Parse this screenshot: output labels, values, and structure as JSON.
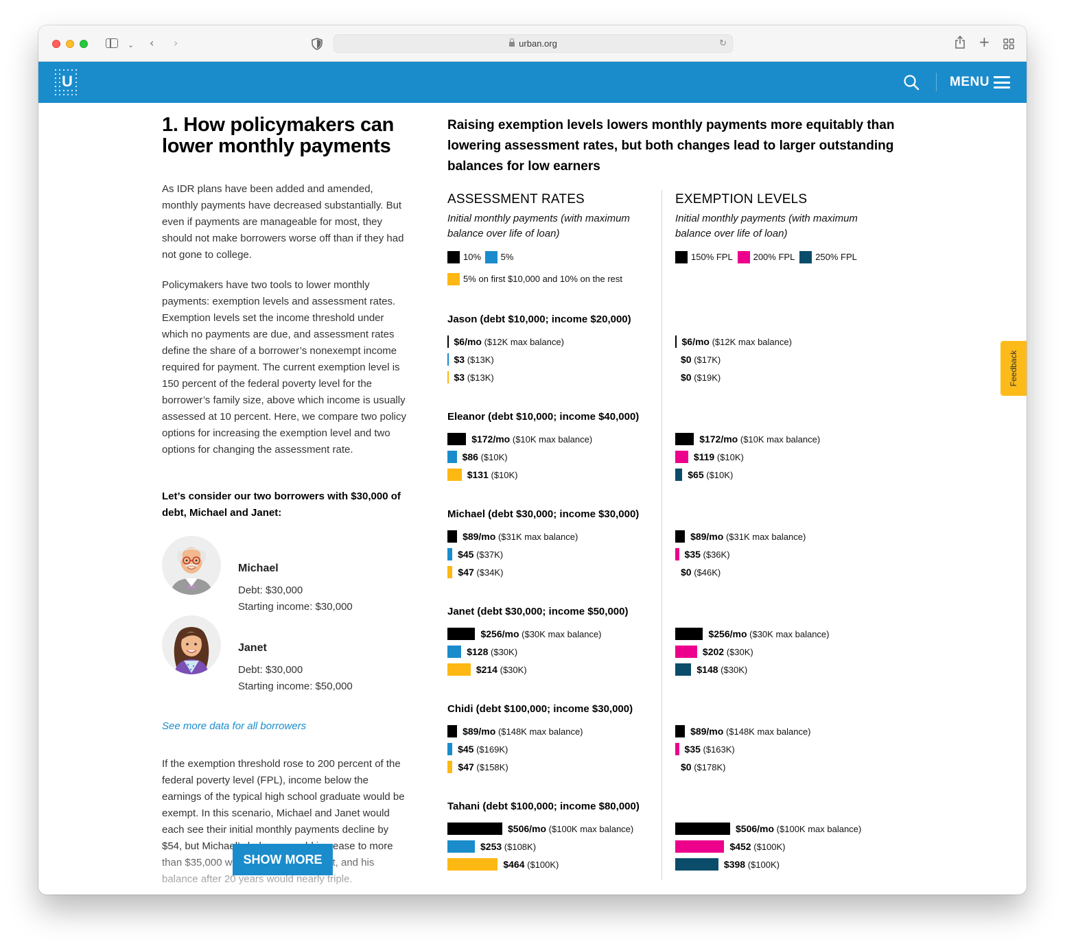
{
  "browser": {
    "url": "urban.org"
  },
  "header": {
    "menu_label": "MENU",
    "logo_letter": "U"
  },
  "article": {
    "title": "1. How policymakers can lower monthly payments",
    "para1": "As IDR plans have been added and amended, monthly payments have decreased substantially. But even if payments are manageable for most, they should not make borrowers worse off than if they had not gone to college.",
    "para2": "Policymakers have two tools to lower monthly payments: exemption levels and assessment rates. Exemption levels set the income threshold under which no payments are due, and assessment rates define the share of a borrower’s nonexempt income required for payment. The current exemption level is 150 percent of the federal poverty level for the borrower’s family size, above which income is usually assessed at 10 percent. Here, we compare two policy options for increasing the exemption level and two options for changing the assessment rate.",
    "consider": "Let’s consider our two borrowers with $30,000 of debt, Michael and Janet:",
    "people": [
      {
        "name": "Michael",
        "debt": "Debt: $30,000",
        "income": "Starting income: $30,000"
      },
      {
        "name": "Janet",
        "debt": "Debt: $30,000",
        "income": "Starting income: $50,000"
      }
    ],
    "more_link": "See more data for all borrowers",
    "para3": "If the exemption threshold rose to 200 percent of the federal poverty level (FPL), income below the earnings of the typical high school graduate would be exempt. In this scenario, Michael and Janet would each see their initial monthly payments decline by $54, but Michael’s balance would increase to more than $35,000 while he is in repayment, and his balance after 20 years would nearly triple.",
    "show_more": "SHOW MORE"
  },
  "feedback": "Feedback",
  "chart_data": {
    "type": "bar",
    "title": "Raising exemption levels lowers monthly payments more equitably than lowering assessment rates, but both changes lead to larger outstanding balances for low earners",
    "units": "$/mo",
    "panels": [
      {
        "title": "ASSESSMENT RATES",
        "subtitle": "Initial monthly payments (with maximum balance over life of loan)",
        "legend": [
          {
            "name": "10%",
            "color": "#000000"
          },
          {
            "name": "5%",
            "color": "#1a8ccc"
          },
          {
            "name": "5% on first $10,000 and 10% on the rest",
            "color": "#fdb813"
          }
        ],
        "groups": [
          {
            "label": "Jason (debt $10,000; income $20,000)",
            "bars": [
              {
                "value": 6,
                "value_label": "$6/mo",
                "note": "($12K max balance)"
              },
              {
                "value": 3,
                "value_label": "$3",
                "note": "($13K)"
              },
              {
                "value": 3,
                "value_label": "$3",
                "note": "($13K)"
              }
            ]
          },
          {
            "label": "Eleanor (debt $10,000; income $40,000)",
            "bars": [
              {
                "value": 172,
                "value_label": "$172/mo",
                "note": "($10K max balance)"
              },
              {
                "value": 86,
                "value_label": "$86",
                "note": "($10K)"
              },
              {
                "value": 131,
                "value_label": "$131",
                "note": "($10K)"
              }
            ]
          },
          {
            "label": "Michael (debt $30,000; income $30,000)",
            "bars": [
              {
                "value": 89,
                "value_label": "$89/mo",
                "note": "($31K max balance)"
              },
              {
                "value": 45,
                "value_label": "$45",
                "note": "($37K)"
              },
              {
                "value": 47,
                "value_label": "$47",
                "note": "($34K)"
              }
            ]
          },
          {
            "label": "Janet (debt $30,000; income $50,000)",
            "bars": [
              {
                "value": 256,
                "value_label": "$256/mo",
                "note": "($30K max balance)"
              },
              {
                "value": 128,
                "value_label": "$128",
                "note": "($30K)"
              },
              {
                "value": 214,
                "value_label": "$214",
                "note": "($30K)"
              }
            ]
          },
          {
            "label": "Chidi (debt $100,000; income $30,000)",
            "bars": [
              {
                "value": 89,
                "value_label": "$89/mo",
                "note": "($148K max balance)"
              },
              {
                "value": 45,
                "value_label": "$45",
                "note": "($169K)"
              },
              {
                "value": 47,
                "value_label": "$47",
                "note": "($158K)"
              }
            ]
          },
          {
            "label": "Tahani (debt $100,000; income $80,000)",
            "bars": [
              {
                "value": 506,
                "value_label": "$506/mo",
                "note": "($100K max balance)"
              },
              {
                "value": 253,
                "value_label": "$253",
                "note": "($108K)"
              },
              {
                "value": 464,
                "value_label": "$464",
                "note": "($100K)"
              }
            ]
          }
        ]
      },
      {
        "title": "EXEMPTION LEVELS",
        "subtitle": "Initial monthly payments (with maximum balance over life of loan)",
        "legend": [
          {
            "name": "150% FPL",
            "color": "#000000"
          },
          {
            "name": "200% FPL",
            "color": "#ec008c"
          },
          {
            "name": "250% FPL",
            "color": "#0a4c6a"
          }
        ],
        "groups": [
          {
            "label": "",
            "bars": [
              {
                "value": 6,
                "value_label": "$6/mo",
                "note": "($12K max balance)"
              },
              {
                "value": 0,
                "value_label": "$0",
                "note": "($17K)"
              },
              {
                "value": 0,
                "value_label": "$0",
                "note": "($19K)"
              }
            ]
          },
          {
            "label": "",
            "bars": [
              {
                "value": 172,
                "value_label": "$172/mo",
                "note": "($10K max balance)"
              },
              {
                "value": 119,
                "value_label": "$119",
                "note": "($10K)"
              },
              {
                "value": 65,
                "value_label": "$65",
                "note": "($10K)"
              }
            ]
          },
          {
            "label": "",
            "bars": [
              {
                "value": 89,
                "value_label": "$89/mo",
                "note": "($31K max balance)"
              },
              {
                "value": 35,
                "value_label": "$35",
                "note": "($36K)"
              },
              {
                "value": 0,
                "value_label": "$0",
                "note": "($46K)"
              }
            ]
          },
          {
            "label": "",
            "bars": [
              {
                "value": 256,
                "value_label": "$256/mo",
                "note": "($30K max balance)"
              },
              {
                "value": 202,
                "value_label": "$202",
                "note": "($30K)"
              },
              {
                "value": 148,
                "value_label": "$148",
                "note": "($30K)"
              }
            ]
          },
          {
            "label": "",
            "bars": [
              {
                "value": 89,
                "value_label": "$89/mo",
                "note": "($148K max balance)"
              },
              {
                "value": 35,
                "value_label": "$35",
                "note": "($163K)"
              },
              {
                "value": 0,
                "value_label": "$0",
                "note": "($178K)"
              }
            ]
          },
          {
            "label": "",
            "bars": [
              {
                "value": 506,
                "value_label": "$506/mo",
                "note": "($100K max balance)"
              },
              {
                "value": 452,
                "value_label": "$452",
                "note": "($100K)"
              },
              {
                "value": 398,
                "value_label": "$398",
                "note": "($100K)"
              }
            ]
          }
        ]
      }
    ]
  }
}
